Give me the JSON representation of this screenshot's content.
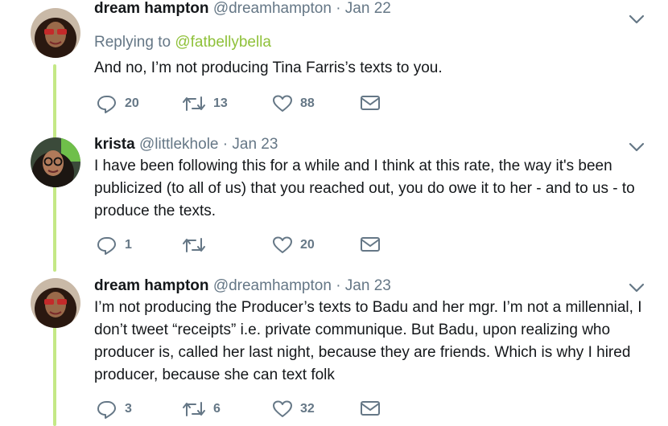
{
  "tweets": [
    {
      "name": "dream hampton",
      "handle": "@dreamhampton",
      "date": "Jan 22",
      "replying_prefix": "Replying to ",
      "replying_to": "@fatbellybella",
      "text": "And no, I’m not producing Tina Farris’s texts to you.",
      "replies": "20",
      "retweets": "13",
      "likes": "88"
    },
    {
      "name": "krista",
      "handle": "@littlekhole",
      "date": "Jan 23",
      "text": "I have been following this for a while and I think at this rate, the way it's been publicized (to all of us) that you reached out, you do owe it to her - and to us - to produce the texts.",
      "replies": "1",
      "retweets": "",
      "likes": "20"
    },
    {
      "name": "dream hampton",
      "handle": "@dreamhampton",
      "date": "Jan 23",
      "text": "I’m not producing the Producer’s texts to Badu and her mgr. I’m not a millennial, I don’t tweet “receipts” i.e. private communique. But Badu, upon realizing who producer is, called her last night, because they are friends. Which is why I hired producer, because she can text folk",
      "replies": "3",
      "retweets": "6",
      "likes": "32"
    }
  ],
  "separator": "·",
  "colors": {
    "thread_line": "#c4e886",
    "mention": "#8fc13a",
    "secondary": "#657786"
  },
  "icons": [
    "chevron-down-icon",
    "reply-icon",
    "retweet-icon",
    "like-icon",
    "message-icon"
  ]
}
